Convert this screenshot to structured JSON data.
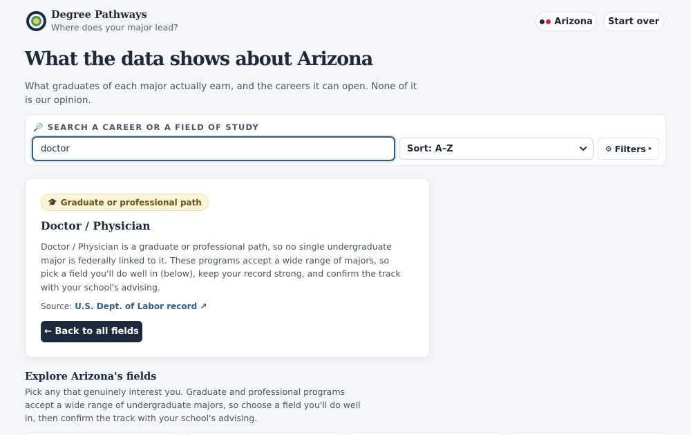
{
  "header": {
    "brand_name": "Degree Pathways",
    "brand_tagline": "Where does your major lead?",
    "state_label": "Arizona",
    "start_over_label": "Start over"
  },
  "page": {
    "title": "What the data shows about Arizona",
    "intro": "What graduates of each major actually earn, and the careers it can open. None of it is our opinion."
  },
  "search": {
    "label": "SEARCH A CAREER OR A FIELD OF STUDY",
    "value": "doctor",
    "sort_value": "Sort: A–Z",
    "filters_label": "Filters"
  },
  "result": {
    "badge": "Graduate or professional path",
    "title": "Doctor / Physician",
    "description": "Doctor / Physician is a graduate or professional path, so no single undergraduate major is federally linked to it. These programs accept a wide range of majors, so pick a field you'll do well in (below), keep your record strong, and confirm the track with your school's advising.",
    "source_prefix": "Source:",
    "source_link": "U.S. Dept. of Labor record ↗",
    "back_label": "← Back to all fields"
  },
  "explore": {
    "title": "Explore Arizona's fields",
    "description": "Pick any that genuinely interest you. Graduate and professional programs accept a wide range of undergraduate majors, so choose a field you'll do well in, then confirm the track with your school's advising."
  },
  "icons": {
    "logo": "target-logo-icon",
    "search": "magnifier-icon",
    "filters": "gear-icon",
    "badge": "graduation-cap-icon",
    "sort": "chevron-down-icon"
  },
  "colors": {
    "navy": "#1e2a3b",
    "link": "#2d5f8a",
    "badge_bg": "#fdf4d9",
    "state_red": "#c8283a"
  }
}
